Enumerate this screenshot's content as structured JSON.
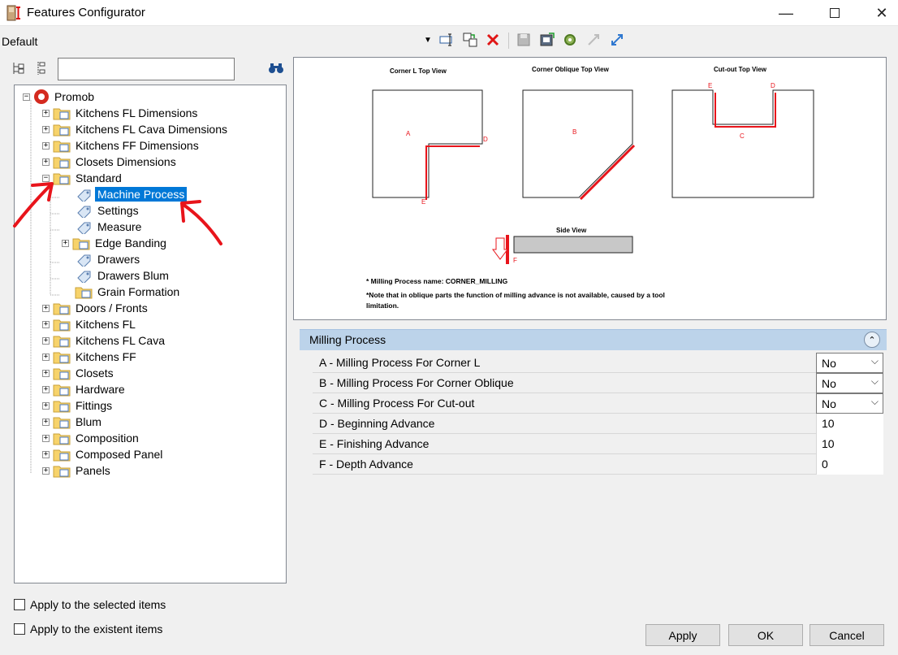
{
  "window": {
    "title": "Features Configurator"
  },
  "toolbar": {
    "profile": "Default"
  },
  "tree": {
    "root": "Promob",
    "items": [
      "Kitchens FL Dimensions",
      "Kitchens FL Cava Dimensions",
      "Kitchens FF Dimensions",
      "Closets Dimensions",
      "Standard",
      "Machine Process",
      "Settings",
      "Measure",
      "Edge Banding",
      "Drawers",
      "Drawers Blum",
      "Grain Formation",
      "Doors / Fronts",
      "Kitchens FL",
      "Kitchens FL Cava",
      "Kitchens FF",
      "Closets",
      "Hardware",
      "Fittings",
      "Blum",
      "Composition",
      "Composed Panel",
      "Panels"
    ]
  },
  "options": {
    "apply_selected": "Apply to the selected items",
    "apply_existent": "Apply to the existent items"
  },
  "preview": {
    "corner_l_title": "Corner L Top View",
    "corner_oblique_title": "Corner Oblique Top View",
    "cutout_title": "Cut-out Top View",
    "side_title": "Side View",
    "labels": {
      "a": "A",
      "b": "B",
      "c": "C",
      "d": "D",
      "e": "E",
      "f": "F"
    },
    "note1": "* Milling Process name: CORNER_MILLING",
    "note2a": "*Note that in oblique parts the function of milling advance is not available, caused by a tool",
    "note2b": "limitation."
  },
  "properties": {
    "section_title": "Milling Process",
    "rows": [
      {
        "label": "A -  Milling Process For Corner L",
        "value": "No"
      },
      {
        "label": "B -  Milling Process For Corner Oblique",
        "value": "No"
      },
      {
        "label": "C -  Milling Process For Cut-out",
        "value": "No"
      },
      {
        "label": "D -  Beginning Advance",
        "value": "10"
      },
      {
        "label": "E -  Finishing Advance",
        "value": "10"
      },
      {
        "label": "F -  Depth Advance",
        "value": "0"
      }
    ]
  },
  "buttons": {
    "apply": "Apply",
    "ok": "OK",
    "cancel": "Cancel"
  },
  "colors": {
    "selection": "#0078d7",
    "accent_red": "#e8141b",
    "header_band": "#bcd3ea"
  }
}
